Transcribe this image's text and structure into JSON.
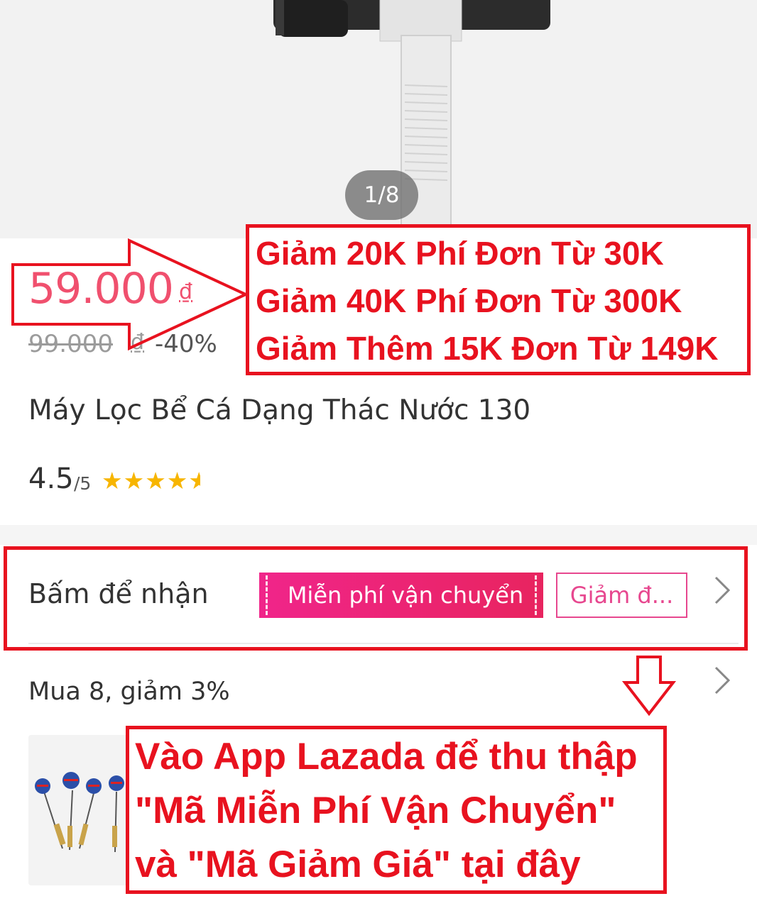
{
  "gallery": {
    "counter": "1/8"
  },
  "price": {
    "current": "59.000",
    "currency": "₫",
    "original": "99.000",
    "original_currency": "₫",
    "discount": "-40%"
  },
  "product": {
    "title": "Máy Lọc Bể Cá Dạng Thác Nước 130"
  },
  "rating": {
    "value": "4.5",
    "max": "/5",
    "stars": 4.5,
    "star_color": "#f7b500"
  },
  "vouchers": {
    "claim_label": "Bấm để nhận",
    "free_shipping": "Miễn phí vận chuyển",
    "discount": "Giảm đ..."
  },
  "bundle": {
    "label": "Mua 8, giảm 3%"
  },
  "annotations": {
    "promo_lines": [
      "Giảm 20K Phí Đơn Từ 30K",
      "Giảm 40K Phí Đơn Từ 300K",
      "Giảm Thêm 15K Đơn Từ 149K"
    ],
    "app_lines": [
      "Vào App Lazada để thu thập",
      "\"Mã Miễn Phí Vận Chuyển\"",
      "và \"Mã Giảm Giá\" tại đây"
    ],
    "color": "#e8121f"
  },
  "colors": {
    "price": "#f0506e",
    "voucher_pink": "#f0258a"
  }
}
